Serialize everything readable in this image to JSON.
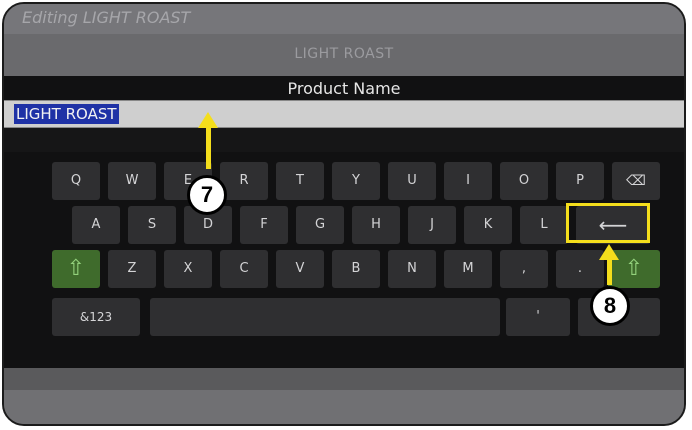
{
  "titlebar": {
    "text": "Editing LIGHT ROAST"
  },
  "header": {
    "title": "LIGHT ROAST"
  },
  "field": {
    "label": "Product Name",
    "value": "LIGHT ROAST"
  },
  "keyboard": {
    "row1": [
      "Q",
      "W",
      "E",
      "R",
      "T",
      "Y",
      "U",
      "I",
      "O",
      "P"
    ],
    "row2": [
      "A",
      "S",
      "D",
      "F",
      "G",
      "H",
      "J",
      "K",
      "L"
    ],
    "row3": [
      "Z",
      "X",
      "C",
      "V",
      "B",
      "N",
      "M",
      ",",
      "."
    ],
    "symbols_label": "&123",
    "backspace_glyph": "⌫",
    "enter_glyph": "⟵",
    "shift_glyph": "⇧",
    "apostrophe": "'"
  },
  "annotations": {
    "callout_7": "7",
    "callout_8": "8",
    "accent_color": "#f4de1c"
  }
}
